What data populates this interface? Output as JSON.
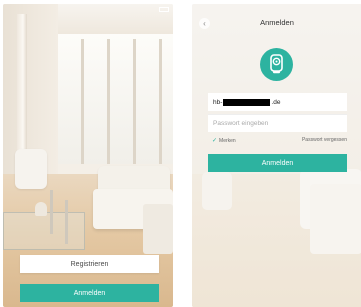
{
  "colors": {
    "accent": "#2db3a0",
    "button_text": "#ffffff"
  },
  "left_screen": {
    "register_label": "Registrieren",
    "login_label": "Anmelden"
  },
  "right_screen": {
    "back_icon": "chevron-left-icon",
    "title": "Anmelden",
    "logo_icon": "camera-icon",
    "email_prefix": "hb-",
    "email_suffix": ".de",
    "password_placeholder": "Passwort eingeben",
    "remember_label": "Merken",
    "forgot_label": "Passwort vergessen",
    "login_label": "Anmelden"
  }
}
